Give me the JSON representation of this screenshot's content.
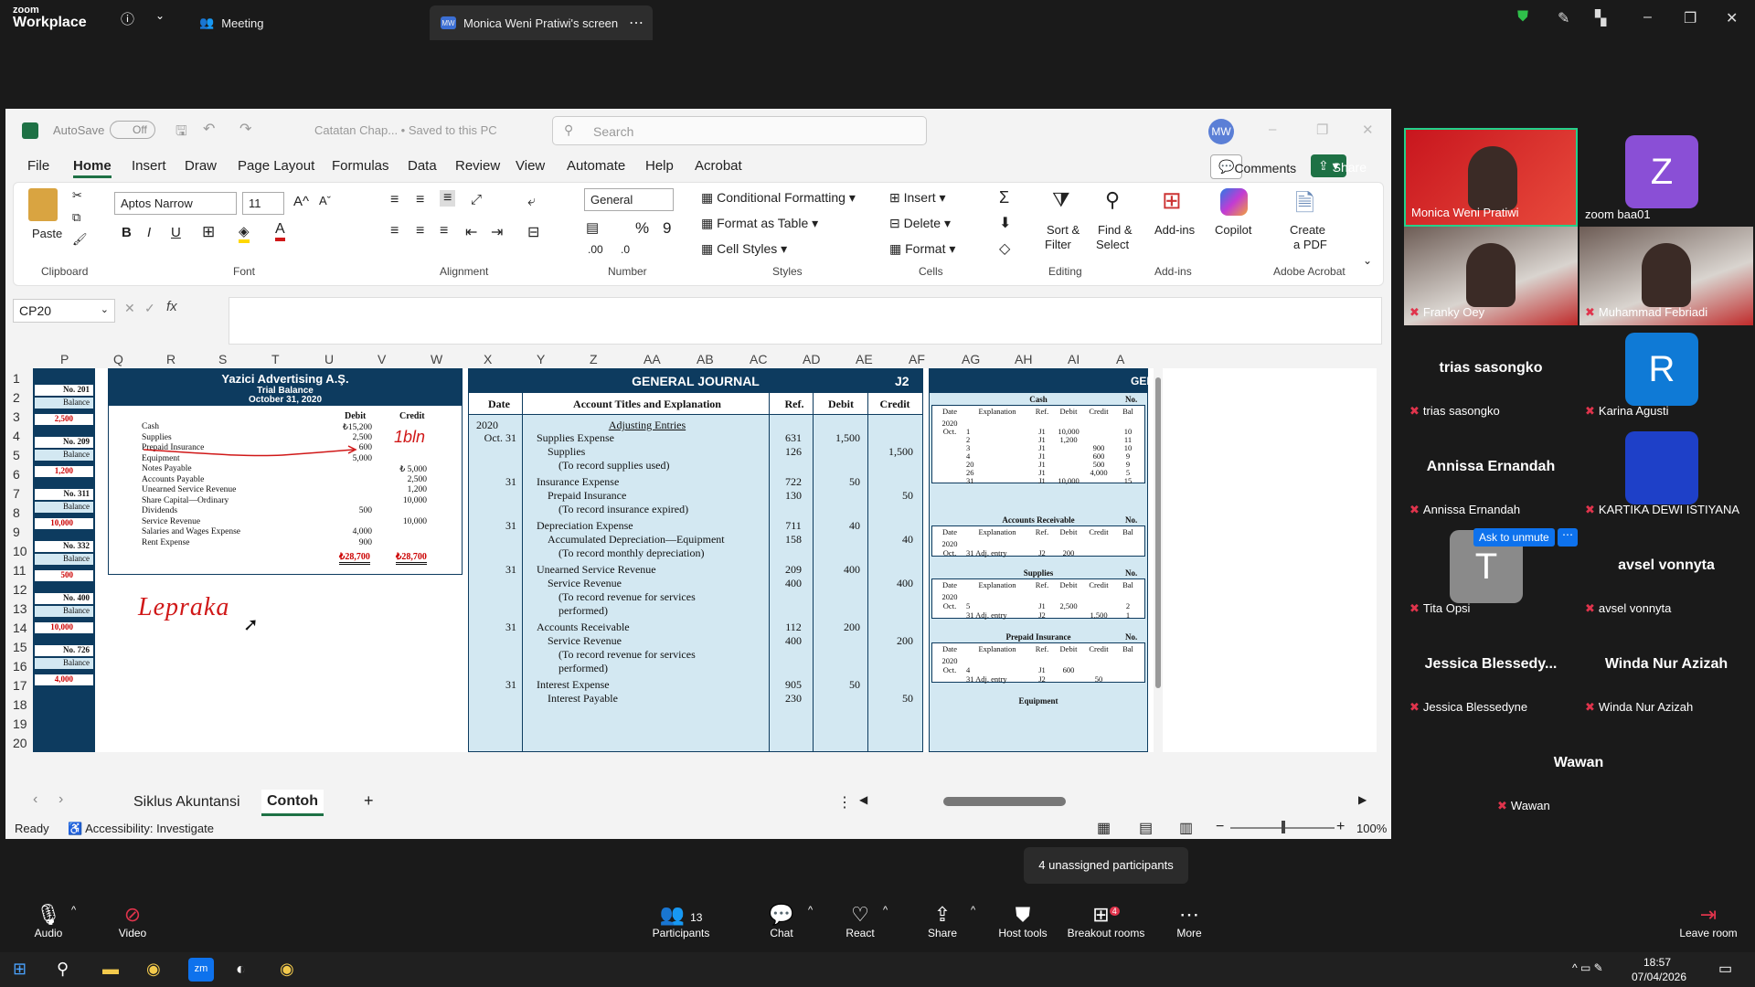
{
  "zoom": {
    "logo_line1": "zoom",
    "logo_line2": "Workplace",
    "meeting_label": "Meeting",
    "share_tab_label": "Monica Weni Pratiwi's screen",
    "share_badge": "MW"
  },
  "excel": {
    "autosave_label": "AutoSave",
    "autosave_state": "Off",
    "file_title": "Catatan Chap... • Saved to this PC",
    "search_placeholder": "Search",
    "user_initials": "MW",
    "menu": [
      "File",
      "Home",
      "Insert",
      "Draw",
      "Page Layout",
      "Formulas",
      "Data",
      "Review",
      "View",
      "Automate",
      "Help",
      "Acrobat"
    ],
    "comments_label": "Comments",
    "share_label": "Share",
    "ribbon": {
      "paste": "Paste",
      "clipboard": "Clipboard",
      "font_name": "Aptos Narrow",
      "font_size": "11",
      "font": "Font",
      "alignment": "Alignment",
      "number_format": "General",
      "number": "Number",
      "conditional_formatting": "Conditional Formatting",
      "format_as_table": "Format as Table",
      "cell_styles": "Cell Styles",
      "styles": "Styles",
      "insert": "Insert",
      "delete": "Delete",
      "format": "Format",
      "cells": "Cells",
      "sort_filter_1": "Sort &",
      "sort_filter_2": "Filter",
      "find_select_1": "Find &",
      "find_select_2": "Select",
      "editing": "Editing",
      "add_ins": "Add-ins",
      "add_ins_group": "Add-ins",
      "copilot": "Copilot",
      "create_pdf_1": "Create",
      "create_pdf_2": "a PDF",
      "adobe_acrobat": "Adobe Acrobat",
      "bold": "B",
      "italic": "I",
      "underline": "U"
    },
    "name_box": "CP20",
    "columns": [
      "P",
      "Q",
      "R",
      "S",
      "T",
      "U",
      "V",
      "W",
      "X",
      "Y",
      "Z",
      "AA",
      "AB",
      "AC",
      "AD",
      "AE",
      "AF",
      "AG",
      "AH",
      "AI",
      "A"
    ],
    "rows": [
      "1",
      "2",
      "3",
      "4",
      "5",
      "6",
      "7",
      "8",
      "9",
      "10",
      "11",
      "12",
      "13",
      "14",
      "15",
      "16",
      "17",
      "18",
      "19",
      "20"
    ],
    "sheet_tabs": [
      "Siklus Akuntansi",
      "Contoh"
    ],
    "status_ready": "Ready",
    "accessibility": "Accessibility: Investigate",
    "zoom_level": "100%"
  },
  "sheet": {
    "left_col": [
      {
        "label": "No. 201",
        "sub": "Balance",
        "val": "2,500"
      },
      {
        "label": "No. 209",
        "sub": "Balance",
        "val": "1,200"
      },
      {
        "label": "No. 311",
        "sub": "Balance",
        "val": "10,000"
      },
      {
        "label": "No. 332",
        "sub": "Balance",
        "val": "500"
      },
      {
        "label": "No. 400",
        "sub": "Balance",
        "val": "10,000"
      },
      {
        "label": "No. 726",
        "sub": "Balance",
        "val": "4,000"
      }
    ],
    "trial_balance": {
      "company": "Yazici Advertising A.Ş.",
      "title": "Trial Balance",
      "date": "October 31, 2020",
      "debit": "Debit",
      "credit": "Credit",
      "rows": [
        {
          "a": "Cash",
          "d": "₺15,200",
          "c": ""
        },
        {
          "a": "Supplies",
          "d": "2,500",
          "c": ""
        },
        {
          "a": "Prepaid Insurance",
          "d": "600",
          "c": ""
        },
        {
          "a": "Equipment",
          "d": "5,000",
          "c": ""
        },
        {
          "a": "Notes Payable",
          "d": "",
          "c": "₺ 5,000"
        },
        {
          "a": "Accounts Payable",
          "d": "",
          "c": "2,500"
        },
        {
          "a": "Unearned Service Revenue",
          "d": "",
          "c": "1,200"
        },
        {
          "a": "Share Capital—Ordinary",
          "d": "",
          "c": "10,000"
        },
        {
          "a": "Dividends",
          "d": "500",
          "c": ""
        },
        {
          "a": "Service Revenue",
          "d": "",
          "c": "10,000"
        },
        {
          "a": "Salaries and Wages Expense",
          "d": "4,000",
          "c": ""
        },
        {
          "a": "Rent Expense",
          "d": "900",
          "c": ""
        }
      ],
      "total_debit": "₺28,700",
      "total_credit": "₺28,700",
      "annotation": "1bln",
      "handwriting": "Lepraka"
    },
    "journal": {
      "title": "GENERAL JOURNAL",
      "page": "J2",
      "headers": [
        "Date",
        "Account Titles and Explanation",
        "Ref.",
        "Debit",
        "Credit"
      ],
      "year": "2020",
      "heading": "Adjusting Entries",
      "entries": [
        {
          "date": "Oct. 31",
          "lines": [
            [
              "Supplies Expense",
              "631",
              "1,500",
              ""
            ],
            [
              "Supplies",
              "126",
              "",
              "1,500"
            ],
            [
              "(To record supplies used)",
              "",
              "",
              ""
            ]
          ]
        },
        {
          "date": "31",
          "lines": [
            [
              "Insurance Expense",
              "722",
              "50",
              ""
            ],
            [
              "Prepaid Insurance",
              "130",
              "",
              "50"
            ],
            [
              "(To record insurance expired)",
              "",
              "",
              ""
            ]
          ]
        },
        {
          "date": "31",
          "lines": [
            [
              "Depreciation Expense",
              "711",
              "40",
              ""
            ],
            [
              "Accumulated Depreciation—Equipment",
              "158",
              "",
              "40"
            ],
            [
              "(To record monthly depreciation)",
              "",
              "",
              ""
            ]
          ]
        },
        {
          "date": "31",
          "lines": [
            [
              "Unearned Service Revenue",
              "209",
              "400",
              ""
            ],
            [
              "Service Revenue",
              "400",
              "",
              "400"
            ],
            [
              "(To record revenue for services",
              "",
              "",
              ""
            ],
            [
              "performed)",
              "",
              "",
              ""
            ]
          ]
        },
        {
          "date": "31",
          "lines": [
            [
              "Accounts Receivable",
              "112",
              "200",
              ""
            ],
            [
              "Service Revenue",
              "400",
              "",
              "200"
            ],
            [
              "(To record revenue for services",
              "",
              "",
              ""
            ],
            [
              "performed)",
              "",
              "",
              ""
            ]
          ]
        },
        {
          "date": "31",
          "lines": [
            [
              "Interest Expense",
              "905",
              "50",
              ""
            ],
            [
              "Interest Payable",
              "230",
              "",
              "50"
            ]
          ]
        }
      ]
    },
    "ledger": {
      "header": "GEN",
      "cash": "Cash",
      "no": "No.",
      "cols": [
        "Date",
        "Explanation",
        "Ref.",
        "Debit",
        "Credit",
        "Bal"
      ],
      "cash_rows": [
        [
          "2020",
          "",
          "",
          "",
          "",
          ""
        ],
        [
          "Oct.",
          "1",
          "J1",
          "10,000",
          "",
          "10"
        ],
        [
          "",
          "2",
          "J1",
          "1,200",
          "",
          "11"
        ],
        [
          "",
          "3",
          "J1",
          "",
          "900",
          "10"
        ],
        [
          "",
          "4",
          "J1",
          "",
          "600",
          "9"
        ],
        [
          "",
          "20",
          "J1",
          "",
          "500",
          "9"
        ],
        [
          "",
          "26",
          "J1",
          "",
          "4,000",
          "5"
        ],
        [
          "",
          "31",
          "J1",
          "10,000",
          "",
          "15"
        ]
      ],
      "ar": "Accounts Receivable",
      "ar_rows": [
        [
          "2020",
          "",
          "",
          "",
          "",
          ""
        ],
        [
          "Oct.",
          "31 Adj. entry",
          "J2",
          "200",
          "",
          ""
        ]
      ],
      "supplies": "Supplies",
      "sup_rows": [
        [
          "2020",
          "",
          "",
          "",
          "",
          ""
        ],
        [
          "Oct.",
          "5",
          "J1",
          "2,500",
          "",
          "2"
        ],
        [
          "",
          "31 Adj. entry",
          "J2",
          "",
          "1,500",
          "1"
        ]
      ],
      "prepaid": "Prepaid Insurance",
      "pre_rows": [
        [
          "2020",
          "",
          "",
          "",
          "",
          ""
        ],
        [
          "Oct.",
          "4",
          "J1",
          "600",
          "",
          ""
        ],
        [
          "",
          "31 Adj. entry",
          "J2",
          "",
          "50",
          ""
        ]
      ],
      "equipment": "Equipment"
    }
  },
  "participants": [
    {
      "name": "Monica Weni Pratiwi",
      "type": "video"
    },
    {
      "name": "zoom baa01",
      "type": "avatar",
      "initial": "Z",
      "color": "#8a4fd6"
    },
    {
      "name": "Franky Oey",
      "type": "video"
    },
    {
      "name": "Muhammad Febriadi",
      "type": "video"
    },
    {
      "name": "trias sasongko",
      "type": "name"
    },
    {
      "name": "Karina Agusti",
      "type": "avatar",
      "initial": "R",
      "color": "#0f7ad6"
    },
    {
      "name": "Annissa Ernandah",
      "type": "name"
    },
    {
      "name": "KARTIKA DEWI ISTIYANA",
      "type": "photo"
    },
    {
      "name": "Tita Opsi",
      "type": "avatar",
      "initial": "T",
      "color": "#8a8a8a"
    },
    {
      "name": "avsel vonnyta",
      "type": "name"
    },
    {
      "name": "Jessica Blessedyne",
      "display": "Jessica  Blessedy...",
      "type": "name"
    },
    {
      "name": "Winda Nur Azizah",
      "type": "name"
    },
    {
      "name": "Wawan",
      "type": "name"
    }
  ],
  "ask_to_unmute": "Ask to unmute",
  "unassigned": "4 unassigned participants",
  "bottom": {
    "audio": "Audio",
    "video": "Video",
    "participants": "Participants",
    "participants_count": "13",
    "chat": "Chat",
    "react": "React",
    "share": "Share",
    "host_tools": "Host tools",
    "breakout": "Breakout rooms",
    "breakout_count": "4",
    "more": "More",
    "leave": "Leave room"
  },
  "taskbar": {
    "time": "18:57",
    "date": "07/04/2026"
  }
}
